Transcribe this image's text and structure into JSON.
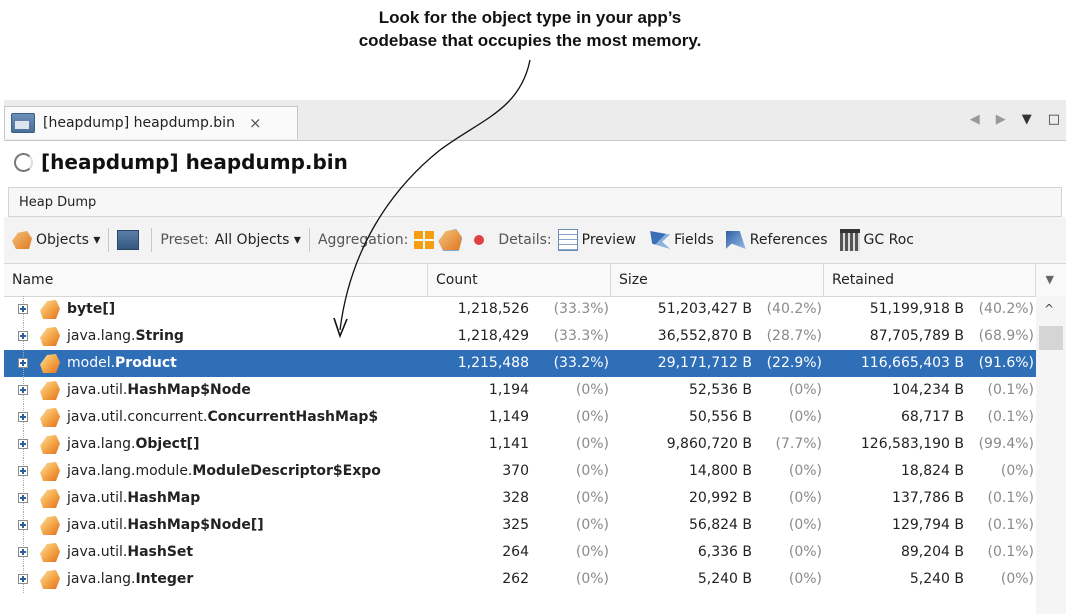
{
  "annotation": {
    "line1": "Look for the object type in your app’s",
    "line2": "codebase that occupies the most memory."
  },
  "tab": {
    "label": "[heapdump] heapdump.bin",
    "close": "×"
  },
  "window_controls": {
    "back": "◀",
    "forward": "▶",
    "menu": "▼",
    "maximize": "□"
  },
  "title": "[heapdump] heapdump.bin",
  "subtab": "Heap Dump",
  "toolbar": {
    "objects": "Objects ▾",
    "preset_label": "Preset:",
    "preset_value": "All Objects ▾",
    "aggregation_label": "Aggregation:",
    "details_label": "Details:",
    "preview": "Preview",
    "fields": "Fields",
    "references": "References",
    "gc_roots": "GC Roc"
  },
  "columns": {
    "name": "Name",
    "count": "Count",
    "size": "Size",
    "retained": "Retained"
  },
  "rows": [
    {
      "pkg": "",
      "cls": "byte[]",
      "count": "1,218,526",
      "count_pct": "(33.3%)",
      "size": "51,203,427 B",
      "size_pct": "(40.2%)",
      "retained": "51,199,918 B",
      "retained_pct": "(40.2%)"
    },
    {
      "pkg": "java.lang.",
      "cls": "String",
      "count": "1,218,429",
      "count_pct": "(33.3%)",
      "size": "36,552,870 B",
      "size_pct": "(28.7%)",
      "retained": "87,705,789 B",
      "retained_pct": "(68.9%)"
    },
    {
      "pkg": "model.",
      "cls": "Product",
      "count": "1,215,488",
      "count_pct": "(33.2%)",
      "size": "29,171,712 B",
      "size_pct": "(22.9%)",
      "retained": "116,665,403 B",
      "retained_pct": "(91.6%)",
      "selected": true
    },
    {
      "pkg": "java.util.",
      "cls": "HashMap$Node",
      "count": "1,194",
      "count_pct": "(0%)",
      "size": "52,536 B",
      "size_pct": "(0%)",
      "retained": "104,234 B",
      "retained_pct": "(0.1%)"
    },
    {
      "pkg": "java.util.concurrent.",
      "cls": "ConcurrentHashMap$",
      "count": "1,149",
      "count_pct": "(0%)",
      "size": "50,556 B",
      "size_pct": "(0%)",
      "retained": "68,717 B",
      "retained_pct": "(0.1%)"
    },
    {
      "pkg": "java.lang.",
      "cls": "Object[]",
      "count": "1,141",
      "count_pct": "(0%)",
      "size": "9,860,720 B",
      "size_pct": "(7.7%)",
      "retained": "126,583,190 B",
      "retained_pct": "(99.4%)"
    },
    {
      "pkg": "java.lang.module.",
      "cls": "ModuleDescriptor$Expo",
      "count": "370",
      "count_pct": "(0%)",
      "size": "14,800 B",
      "size_pct": "(0%)",
      "retained": "18,824 B",
      "retained_pct": "(0%)"
    },
    {
      "pkg": "java.util.",
      "cls": "HashMap",
      "count": "328",
      "count_pct": "(0%)",
      "size": "20,992 B",
      "size_pct": "(0%)",
      "retained": "137,786 B",
      "retained_pct": "(0.1%)"
    },
    {
      "pkg": "java.util.",
      "cls": "HashMap$Node[]",
      "count": "325",
      "count_pct": "(0%)",
      "size": "56,824 B",
      "size_pct": "(0%)",
      "retained": "129,794 B",
      "retained_pct": "(0.1%)"
    },
    {
      "pkg": "java.util.",
      "cls": "HashSet",
      "count": "264",
      "count_pct": "(0%)",
      "size": "6,336 B",
      "size_pct": "(0%)",
      "retained": "89,204 B",
      "retained_pct": "(0.1%)"
    },
    {
      "pkg": "java.lang.",
      "cls": "Integer",
      "count": "262",
      "count_pct": "(0%)",
      "size": "5,240 B",
      "size_pct": "(0%)",
      "retained": "5,240 B",
      "retained_pct": "(0%)"
    }
  ]
}
